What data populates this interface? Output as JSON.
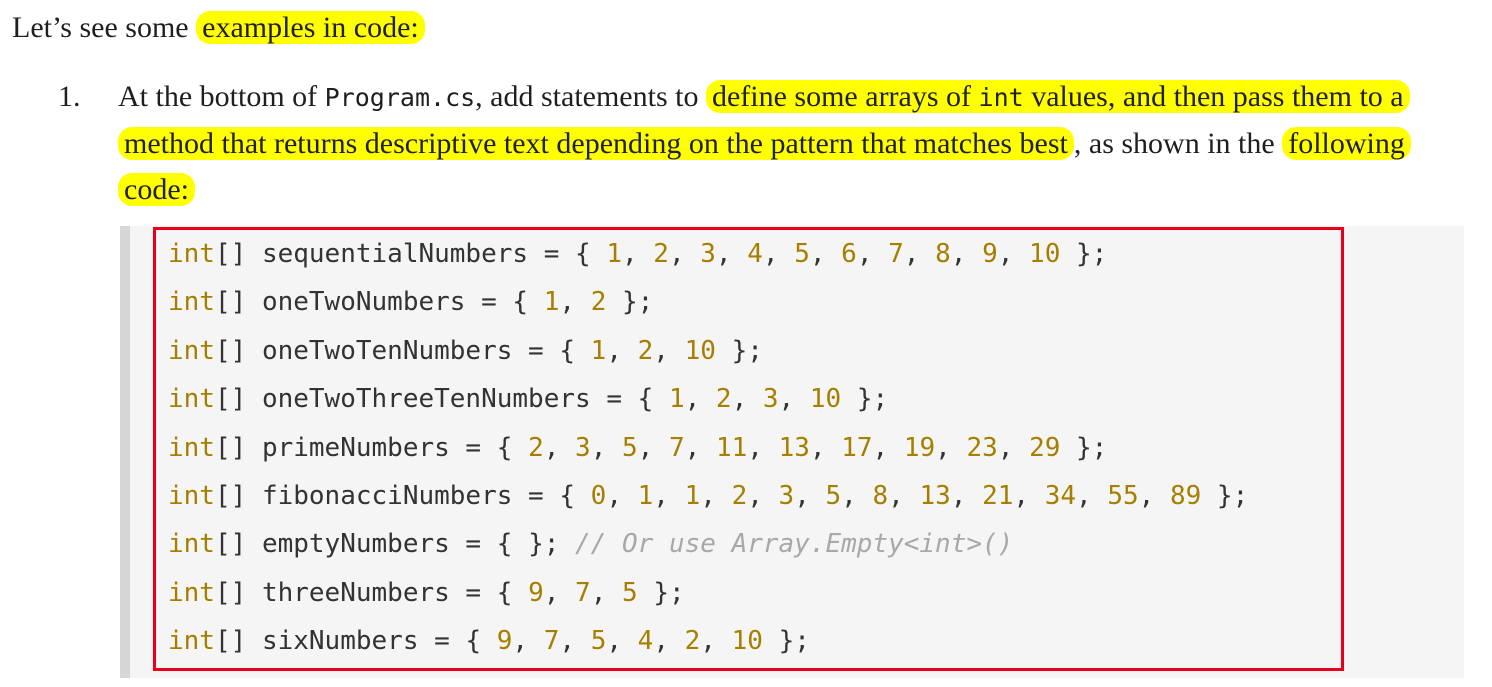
{
  "intro": {
    "prefix": "Let’s see some",
    "highlight": "examples in code:"
  },
  "step": {
    "number": "1.",
    "text_a": "At the bottom of ",
    "code_file": "Program.cs",
    "text_b": ", add statements to ",
    "hl1_a": "define some arrays of ",
    "hl1_code": "int",
    "hl1_b": " values, and then pass them to a method that returns descriptive text depending on the pattern that matches best",
    "text_c": ", as shown in the ",
    "hl2": "following code:"
  },
  "code": {
    "lines": [
      {
        "type": "int[]",
        "name": "sequentialNumbers",
        "values": [
          "1",
          "2",
          "3",
          "4",
          "5",
          "6",
          "7",
          "8",
          "9",
          "10"
        ],
        "comment": ""
      },
      {
        "type": "int[]",
        "name": "oneTwoNumbers",
        "values": [
          "1",
          "2"
        ],
        "comment": ""
      },
      {
        "type": "int[]",
        "name": "oneTwoTenNumbers",
        "values": [
          "1",
          "2",
          "10"
        ],
        "comment": ""
      },
      {
        "type": "int[]",
        "name": "oneTwoThreeTenNumbers",
        "values": [
          "1",
          "2",
          "3",
          "10"
        ],
        "comment": ""
      },
      {
        "type": "int[]",
        "name": "primeNumbers",
        "values": [
          "2",
          "3",
          "5",
          "7",
          "11",
          "13",
          "17",
          "19",
          "23",
          "29"
        ],
        "comment": ""
      },
      {
        "type": "int[]",
        "name": "fibonacciNumbers",
        "values": [
          "0",
          "1",
          "1",
          "2",
          "3",
          "5",
          "8",
          "13",
          "21",
          "34",
          "55",
          "89"
        ],
        "comment": ""
      },
      {
        "type": "int[]",
        "name": "emptyNumbers",
        "values": [],
        "comment": "// Or use Array.Empty<int>()"
      },
      {
        "type": "int[]",
        "name": "threeNumbers",
        "values": [
          "9",
          "7",
          "5"
        ],
        "comment": ""
      },
      {
        "type": "int[]",
        "name": "sixNumbers",
        "values": [
          "9",
          "7",
          "5",
          "4",
          "2",
          "10"
        ],
        "comment": ""
      }
    ]
  },
  "colors": {
    "highlight": "#ffff00",
    "keyword": "#a67f00",
    "number": "#a67f00",
    "comment": "#a8a8a8",
    "frame": "#e8001a"
  }
}
